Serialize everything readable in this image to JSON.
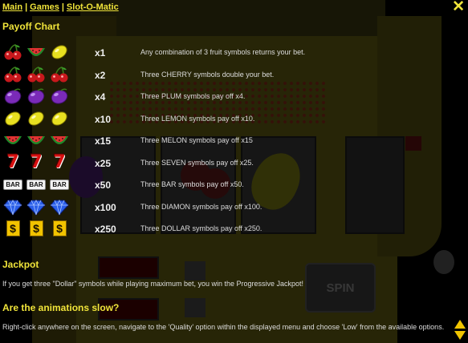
{
  "nav": {
    "main": "Main",
    "separator": "|",
    "games": "Games",
    "slot": "Slot-O-Matic"
  },
  "close_icon": "✕",
  "payoff": {
    "title": "Payoff Chart",
    "rows": [
      {
        "symbols": [
          "cherry",
          "melon",
          "lemon"
        ],
        "mult": "x1",
        "desc": "Any combination of 3 fruit symbols returns your bet."
      },
      {
        "symbols": [
          "cherry",
          "cherry",
          "cherry"
        ],
        "mult": "x2",
        "desc": "Three CHERRY symbols double your bet."
      },
      {
        "symbols": [
          "plum",
          "plum",
          "plum"
        ],
        "mult": "x4",
        "desc": "Three PLUM symbols pay off x4."
      },
      {
        "symbols": [
          "lemon",
          "lemon",
          "lemon"
        ],
        "mult": "x10",
        "desc": "Three LEMON symbols pay off x10."
      },
      {
        "symbols": [
          "melon",
          "melon",
          "melon"
        ],
        "mult": "x15",
        "desc": "Three MELON symbols pay off x15"
      },
      {
        "symbols": [
          "seven",
          "seven",
          "seven"
        ],
        "mult": "x25",
        "desc": "Three SEVEN symbols pay off x25."
      },
      {
        "symbols": [
          "bar",
          "bar",
          "bar"
        ],
        "mult": "x50",
        "desc": "Three BAR symbols pay off x50."
      },
      {
        "symbols": [
          "diamond",
          "diamond",
          "diamond"
        ],
        "mult": "x100",
        "desc": "Three DIAMON symbols pay off x100."
      },
      {
        "symbols": [
          "dollar",
          "dollar",
          "dollar"
        ],
        "mult": "x250",
        "desc": "Three DOLLAR symbols pay off x250."
      }
    ]
  },
  "symbol_text": {
    "seven": "7",
    "bar": "BAR",
    "dollar": "$"
  },
  "jackpot": {
    "title": "Jackpot",
    "text": "If you get three \"Dollar\" symbols while playing maximum bet, you win the Progressive Jackpot!"
  },
  "animations": {
    "title": "Are the animations slow?",
    "text": "Right-click anywhere on the screen, navigate to the 'Quality' option within the displayed menu and choose 'Low' from the available options."
  },
  "background": {
    "spin_label": "SPIN"
  },
  "colors": {
    "accent": "#f0e43a",
    "text": "#dddddd",
    "cherry": "#c8181c",
    "plum": "#7a2ab8",
    "lemon": "#e8e020",
    "melon_rind": "#1f8a2a",
    "melon_flesh": "#e23232",
    "diamond": "#2a5ee8"
  },
  "icons": {
    "close": "close-icon",
    "scroll_up": "scroll-up-arrow-icon",
    "scroll_down": "scroll-down-arrow-icon"
  }
}
